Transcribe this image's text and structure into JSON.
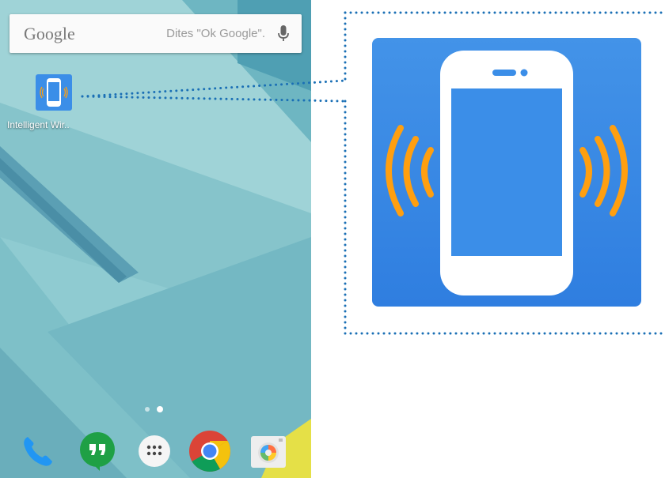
{
  "search_bar": {
    "brand": "Google",
    "hint": "Dites \"Ok Google\"."
  },
  "home_shortcut": {
    "label": "Intelligent Wir.."
  },
  "page_indicator": {
    "pages": 2,
    "active_index": 1
  },
  "dock": {
    "apps": [
      "phone-icon",
      "hangouts-icon",
      "app-drawer-icon",
      "chrome-icon",
      "camera-icon"
    ]
  },
  "colors": {
    "wallpaper_base": "#8cc8d0",
    "app_icon_blue": "#3b8ee8",
    "vibration_orange": "#ff9f10",
    "callout_dots": "#1a6fb5"
  }
}
